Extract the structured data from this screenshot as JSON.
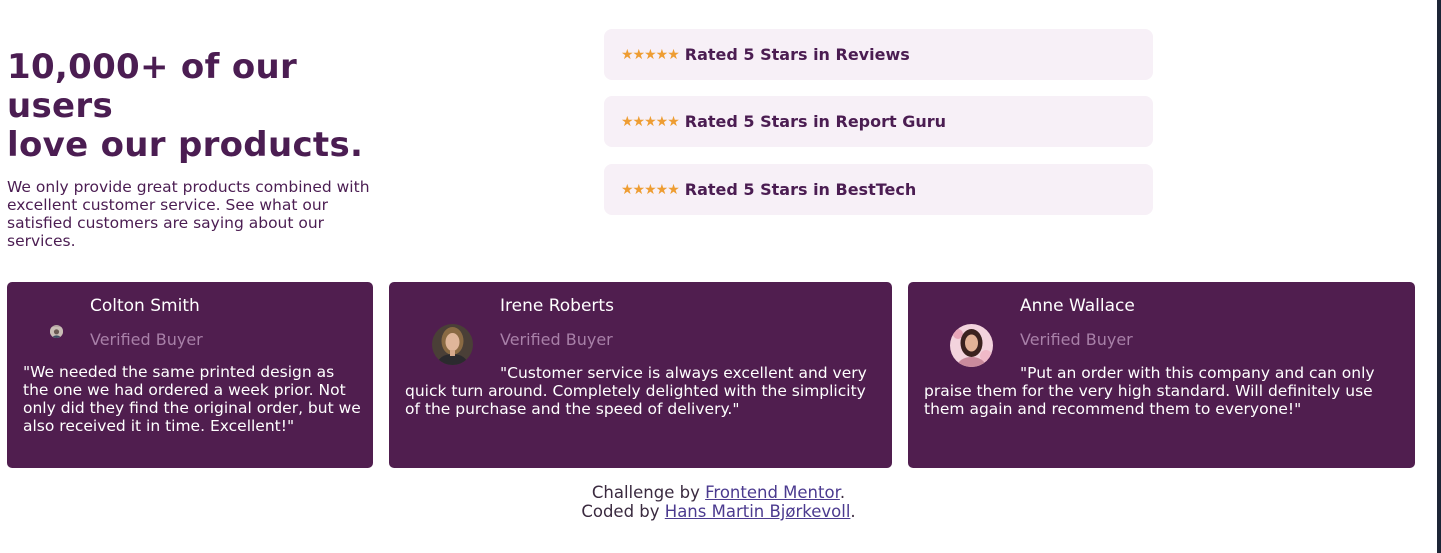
{
  "hero": {
    "headline_line1": "10,000+ of our users",
    "headline_line2": "love our products.",
    "intro_text": "We only provide great products combined with excellent customer service. See what our satisfied customers are saying about our services."
  },
  "ratings": [
    {
      "stars": "★★★★★",
      "stars_count": 5,
      "text": "Rated 5 Stars in Reviews"
    },
    {
      "stars": "★★★★★",
      "stars_count": 5,
      "text": "Rated 5 Stars in Report Guru"
    },
    {
      "stars": "★★★★★",
      "stars_count": 5,
      "text": "Rated 5 Stars in BestTech"
    }
  ],
  "testimonials": [
    {
      "name": "Colton Smith",
      "badge": "Verified Buyer",
      "quote": "\"We needed the same printed design as the one we had ordered a week prior. Not only did they find the original order, but we also received it in time. Excellent!\""
    },
    {
      "name": "Irene Roberts",
      "badge": "Verified Buyer",
      "quote": "\"Customer service is always excellent and very quick turn around. Completely delighted with the simplicity of the purchase and the speed of delivery.\""
    },
    {
      "name": "Anne Wallace",
      "badge": "Verified Buyer",
      "quote": "\"Put an order with this company and can only praise them for the very high standard. Will definitely use them again and recommend them to everyone!\""
    }
  ],
  "footer": {
    "challenge_prefix": "Challenge by",
    "challenge_link": "Frontend Mentor",
    "coded_prefix": "Coded by",
    "coded_link": "Hans Martin Bjørkevoll",
    "period": "."
  },
  "colors": {
    "primary": "#4b1d52",
    "card_bg": "#501e4f",
    "rating_bg": "#f7f0f7",
    "star": "#ee9d33",
    "verified": "#a880a8"
  }
}
